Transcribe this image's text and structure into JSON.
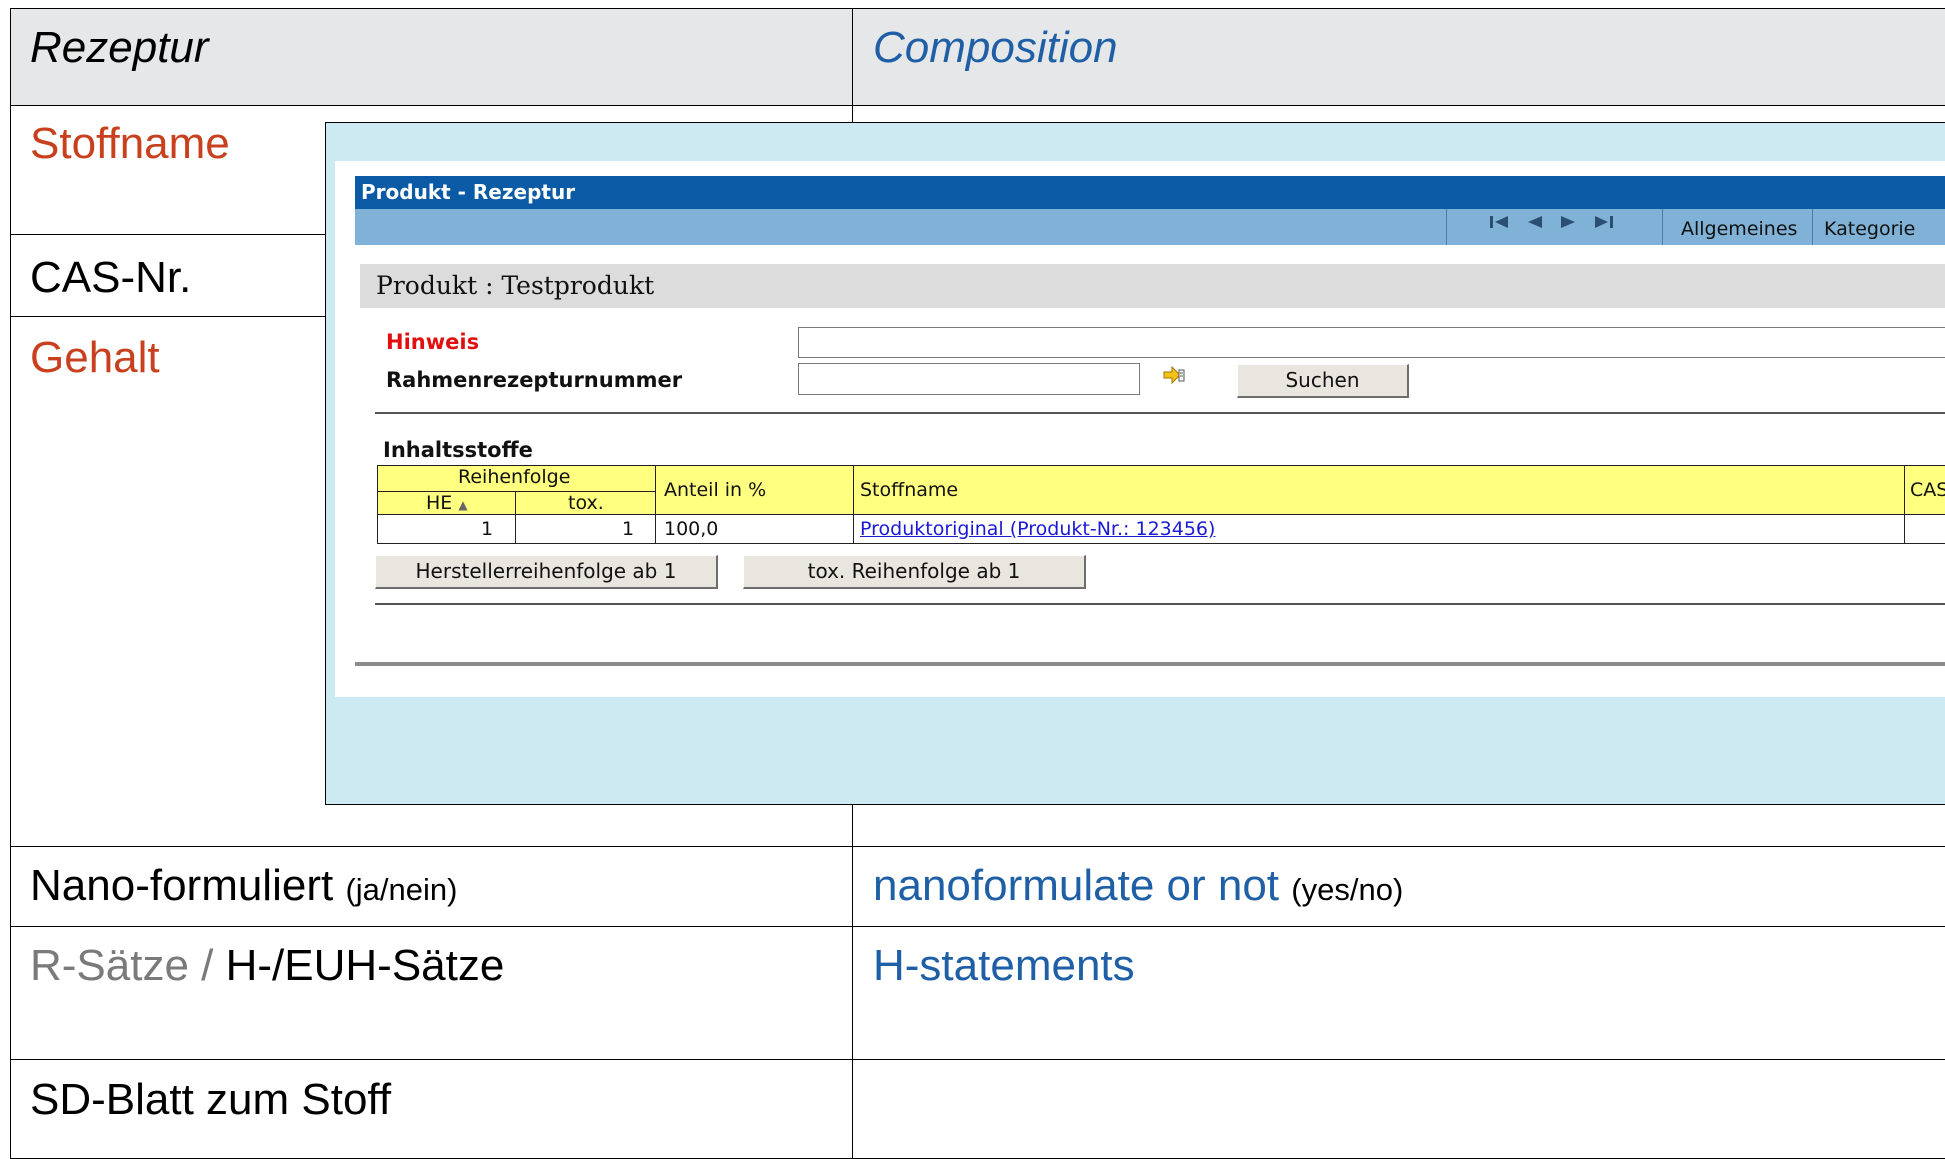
{
  "slide": {
    "header_left": "Rezeptur",
    "header_right": "Composition",
    "rows": {
      "stoffname": "Stoffname",
      "cas": "CAS-Nr.",
      "gehalt": "Gehalt",
      "nano_de": "Nano-formuliert",
      "nano_de_hint": "(ja/nein)",
      "nano_en": "nanoformulate or not",
      "nano_en_hint": "(yes/no)",
      "r_saetze": "R-Sätze /",
      "h_saetze": "H-/EUH-Sätze",
      "h_statements": "H-statements",
      "sd_blatt": "SD-Blatt zum Stoff"
    },
    "colors": {
      "header_bg": "#e6e7e9",
      "red_label": "#c8401e",
      "blue_label": "#1f5fa6",
      "overlay_bg": "#cde9f1"
    }
  },
  "app": {
    "window_title": "Produkt - Rezeptur",
    "nav_icons": [
      "first-record-icon",
      "prev-record-icon",
      "next-record-icon",
      "last-record-icon"
    ],
    "tabs": [
      "Allgemeines",
      "Kategorie"
    ],
    "product_heading": "Produkt : Testprodukt",
    "hinweis_label": "Hinweis",
    "hinweis_value": "",
    "rahmen_label": "Rahmenrezepturnummer",
    "rahmen_value": "",
    "search_button": "Suchen",
    "section_title": "Inhaltsstoffe",
    "table": {
      "group_header": "Reihenfolge",
      "col_he": "HE",
      "col_tox": "tox.",
      "col_anteil": "Anteil in %",
      "col_stoffname": "Stoffname",
      "col_cas": "CAS",
      "rows": [
        {
          "he": "1",
          "tox": "1",
          "anteil": "100,0",
          "stoffname": "Produktoriginal (Produkt-Nr.: 123456)"
        }
      ]
    },
    "btn_hersteller": "Herstellerreihenfolge ab 1",
    "btn_tox": "tox. Reihenfolge ab 1",
    "colors": {
      "titlebar": "#0a5aa5",
      "toolbar": "#7fb2d6",
      "table_header": "#ffff80",
      "link": "#1a1ad6",
      "hinweis": "#e01010"
    }
  }
}
